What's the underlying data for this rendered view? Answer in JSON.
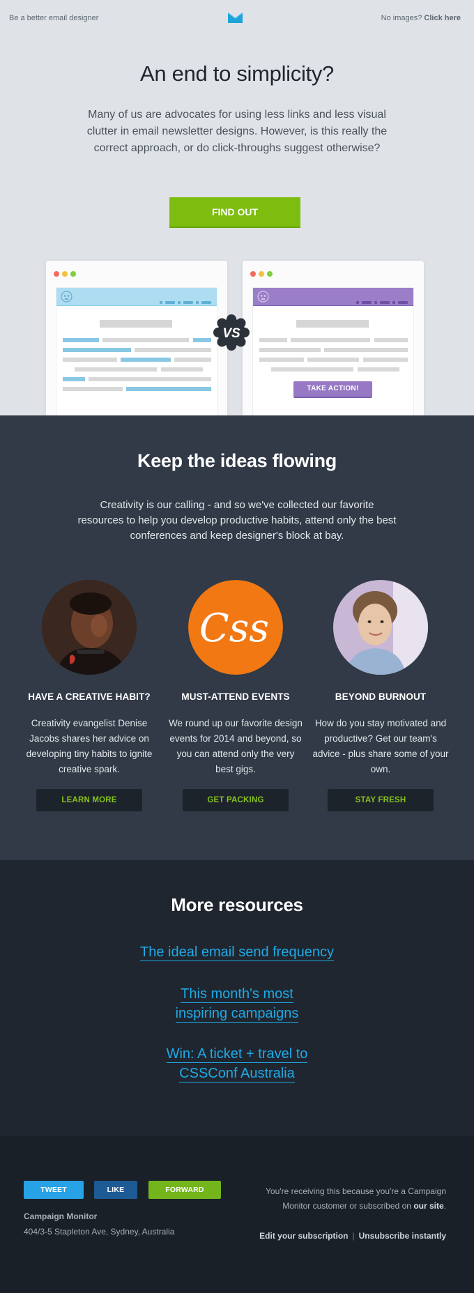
{
  "preheader": {
    "left_text": "Be a better email designer",
    "logo_icon": "envelope-logo-icon",
    "no_images_text": "No images?",
    "click_here_label": "Click here"
  },
  "hero": {
    "title": "An end to simplicity?",
    "body": "Many of us are advocates for using less links and less visual clutter in email newsletter designs. However, is this really the correct approach, or do click-throughs suggest otherwise?",
    "cta_label": "FIND OUT",
    "comparison": {
      "left_accent": "#aeddf2",
      "right_accent": "#9a7ec8",
      "right_button_label": "TAKE ACTION!",
      "vs_label": "VS"
    }
  },
  "ideas": {
    "title": "Keep the ideas flowing",
    "body": "Creativity is our calling - and so we've collected our favorite resources to help you develop productive habits, attend only the best conferences and keep designer's block at bay.",
    "columns": [
      {
        "image": "portrait-denise-jacobs",
        "title": "HAVE A CREATIVE HABIT?",
        "body": "Creativity evangelist Denise Jacobs shares her advice on developing tiny habits to ignite creative spark.",
        "button": "LEARN MORE"
      },
      {
        "image": "css-logo-icon",
        "title": "MUST-ATTEND EVENTS",
        "body": "We round up our favorite design events for 2014 and beyond, so you can attend only the very best gigs.",
        "button": "GET PACKING"
      },
      {
        "image": "portrait-woman-smiling",
        "title": "BEYOND BURNOUT",
        "body": "How do you stay motivated and productive? Get our team's advice - plus share some of your own.",
        "button": "STAY FRESH"
      }
    ]
  },
  "resources": {
    "title": "More resources",
    "links": [
      "The ideal email send frequency",
      "This month's most inspiring campaigns",
      "Win: A ticket + travel to CSSConf Australia"
    ]
  },
  "footer": {
    "social": [
      "TWEET",
      "LIKE",
      "FORWARD"
    ],
    "company": "Campaign Monitor",
    "address": "404/3-5 Stapleton Ave, Sydney, Australia",
    "notice_prefix": "You're receiving this because you're a Campaign Monitor customer or subscribed on",
    "notice_link": "our site",
    "notice_suffix": ".",
    "edit_label": "Edit your subscription",
    "unsubscribe_label": "Unsubscribe instantly"
  },
  "colors": {
    "hero_bg": "#dfe3e7",
    "ideas_bg": "#313a46",
    "resources_bg": "#1f262f",
    "footer_bg": "#1a2028",
    "cta_green": "#7dbd0f",
    "link_blue": "#20a9e6"
  }
}
